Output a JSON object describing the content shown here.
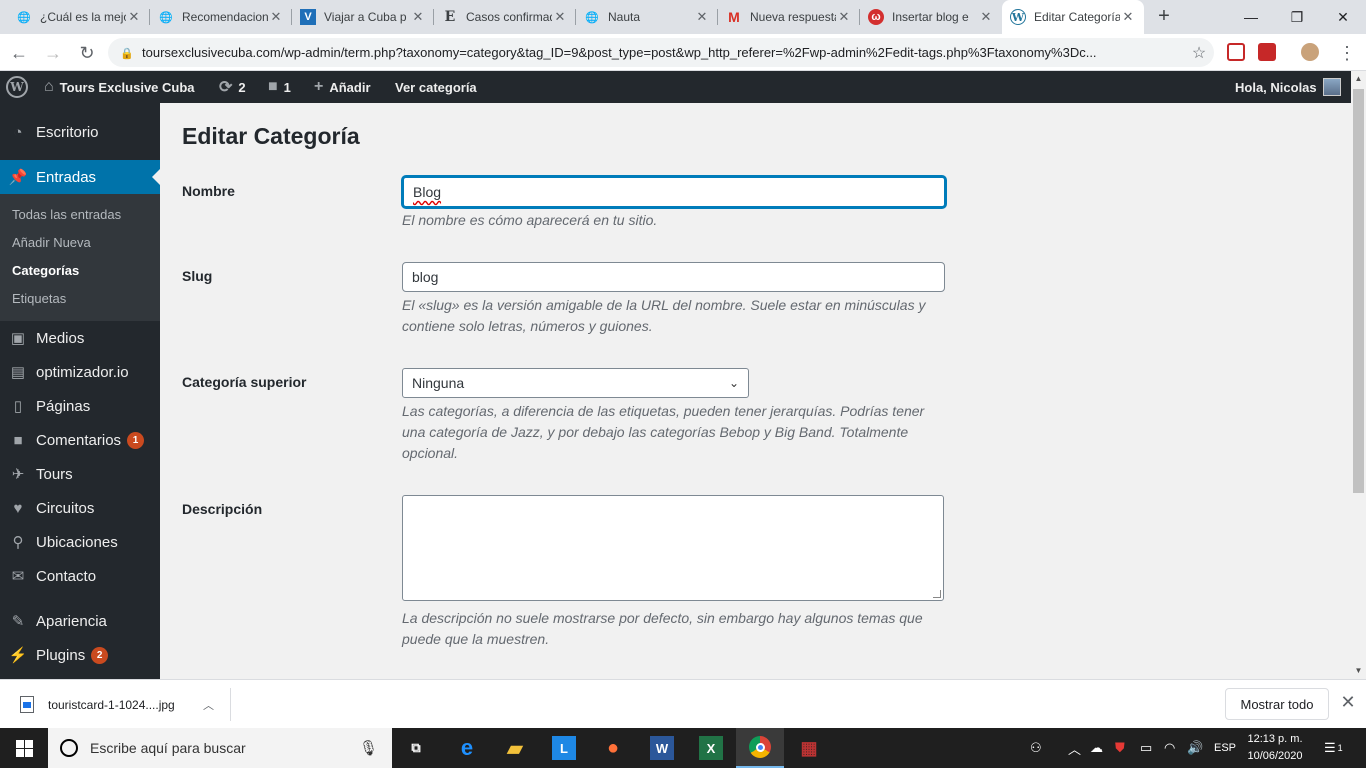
{
  "browser": {
    "tabs": [
      {
        "title": "¿Cuál es la mejor",
        "icon": "globe-icon"
      },
      {
        "title": "Recomendaciones",
        "icon": "globe-icon"
      },
      {
        "title": "Viajar a Cuba p",
        "icon": "v-logo-icon"
      },
      {
        "title": "Casos confirmados",
        "icon": "e-logo-icon"
      },
      {
        "title": "Nauta",
        "icon": "globe-icon"
      },
      {
        "title": "Nueva respuesta",
        "icon": "gmail-icon"
      },
      {
        "title": "Insertar blog e",
        "icon": "w-logo-icon"
      },
      {
        "title": "Editar Categoría",
        "icon": "wordpress-icon"
      }
    ],
    "url": "toursexclusivecuba.com/wp-admin/term.php?taxonomy=category&tag_ID=9&post_type=post&wp_http_referer=%2Fwp-admin%2Fedit-tags.php%3Ftaxonomy%3Dc..."
  },
  "adminbar": {
    "site_name": "Tours Exclusive Cuba",
    "updates_count": "2",
    "comments_count": "1",
    "add_label": "Añadir",
    "view_label": "Ver categoría",
    "greeting": "Hola, Nicolas"
  },
  "sidebar": {
    "items": [
      {
        "label": "Escritorio",
        "icon": "dashboard-icon"
      },
      {
        "label": "Entradas",
        "icon": "pin-icon"
      },
      {
        "label": "Medios",
        "icon": "media-icon"
      },
      {
        "label": "optimizador.io",
        "icon": "optimizer-icon"
      },
      {
        "label": "Páginas",
        "icon": "pages-icon"
      },
      {
        "label": "Comentarios",
        "icon": "comment-icon",
        "badge": "1"
      },
      {
        "label": "Tours",
        "icon": "tours-icon"
      },
      {
        "label": "Circuitos",
        "icon": "heart-icon"
      },
      {
        "label": "Ubicaciones",
        "icon": "location-icon"
      },
      {
        "label": "Contacto",
        "icon": "mail-icon"
      },
      {
        "label": "Apariencia",
        "icon": "brush-icon"
      },
      {
        "label": "Plugins",
        "icon": "plugin-icon",
        "badge": "2"
      }
    ],
    "submenu": [
      "Todas las entradas",
      "Añadir Nueva",
      "Categorías",
      "Etiquetas"
    ]
  },
  "form": {
    "title": "Editar Categoría",
    "name_label": "Nombre",
    "name_value": "Blog",
    "name_desc": "El nombre es cómo aparecerá en tu sitio.",
    "slug_label": "Slug",
    "slug_value": "blog",
    "slug_desc": "El «slug» es la versión amigable de la URL del nombre. Suele estar en minúsculas y contiene solo letras, números y guiones.",
    "parent_label": "Categoría superior",
    "parent_value": "Ninguna",
    "parent_desc": "Las categorías, a diferencia de las etiquetas, pueden tener jerarquías. Podrías tener una categoría de Jazz, y por debajo las categorías Bebop y Big Band. Totalmente opcional.",
    "description_label": "Descripción",
    "description_value": "",
    "description_desc": "La descripción no suele mostrarse por defecto, sin embargo hay algunos temas que puede que la muestren."
  },
  "downloads": {
    "filename": "touristcard-1-1024....jpg",
    "show_all": "Mostrar todo"
  },
  "taskbar": {
    "search_placeholder": "Escribe aquí para buscar",
    "language": "ESP",
    "time": "12:13 p. m.",
    "date": "10/06/2020",
    "notifications": "1"
  },
  "colors": {
    "wp_dark": "#23282d",
    "wp_blue": "#0073aa",
    "badge": "#ca4a1f",
    "focus": "#007cba"
  }
}
